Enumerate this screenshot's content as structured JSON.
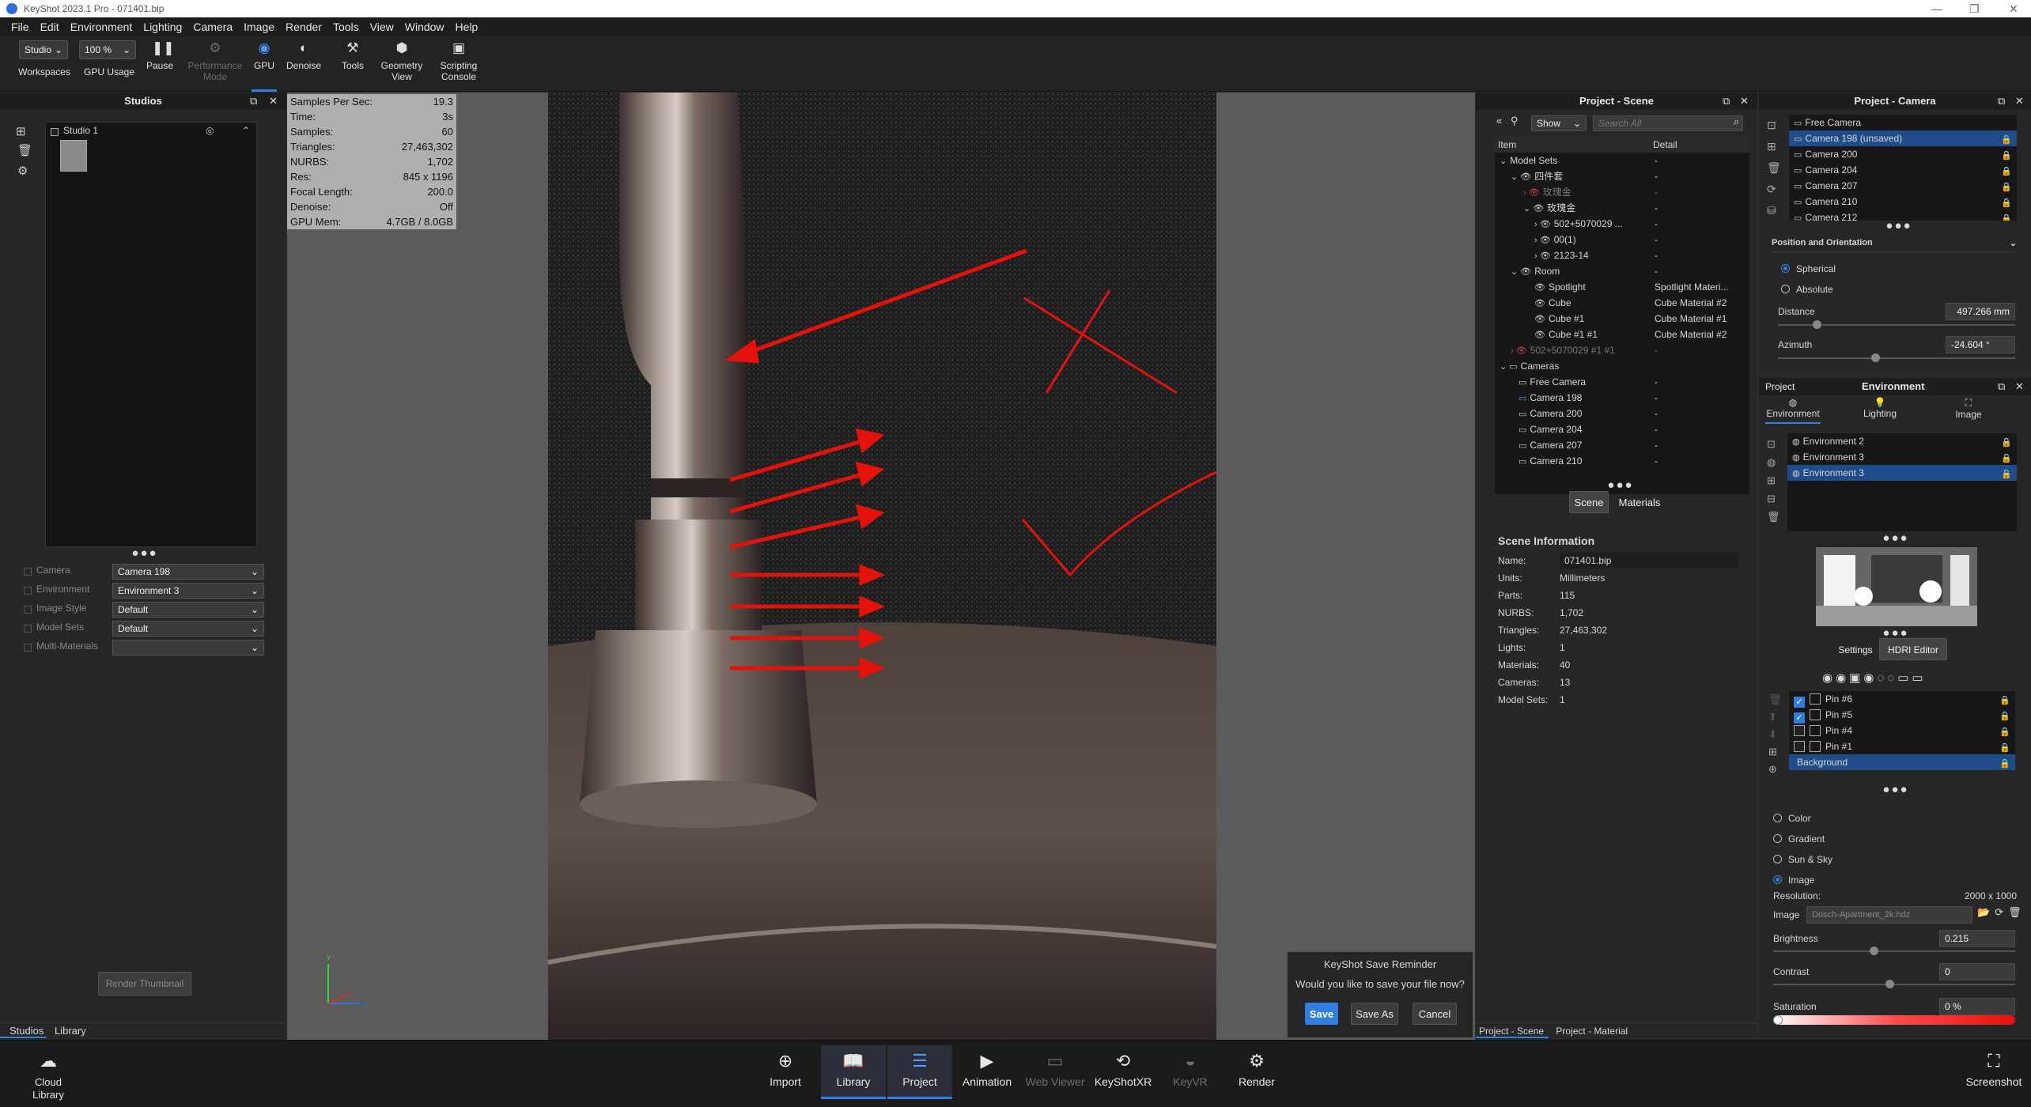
{
  "app": {
    "title": "KeyShot 2023.1 Pro  - 071401.bip",
    "window_controls": [
      "—",
      "❐",
      "✕"
    ]
  },
  "menu": [
    "File",
    "Edit",
    "Environment",
    "Lighting",
    "Camera",
    "Image",
    "Render",
    "Tools",
    "View",
    "Window",
    "Help"
  ],
  "toolbar": {
    "workspace_value": "Studio",
    "workspace_label": "Workspaces",
    "gpu_usage_value": "100 %",
    "gpu_usage_label": "GPU Usage",
    "pause_label": "Pause",
    "performance_label_1": "Performance",
    "performance_label_2": "Mode",
    "gpu_label": "GPU",
    "denoise_label": "Denoise",
    "tools_label": "Tools",
    "geometry_label_1": "Geometry",
    "geometry_label_2": "View",
    "scripting_label_1": "Scripting",
    "scripting_label_2": "Console"
  },
  "studios": {
    "title": "Studios",
    "item": "Studio 1",
    "fields": [
      {
        "label": "Camera",
        "value": "Camera 198"
      },
      {
        "label": "Environment",
        "value": "Environment 3"
      },
      {
        "label": "Image Style",
        "value": "Default"
      },
      {
        "label": "Model Sets",
        "value": "Default"
      },
      {
        "label": "Multi-Materials",
        "value": ""
      }
    ],
    "render_thumbnail": "Render Thumbnail",
    "tabs": [
      "Studios",
      "Library"
    ]
  },
  "stats": [
    {
      "k": "Samples Per Sec:",
      "v": "19.3"
    },
    {
      "k": "Time:",
      "v": "3s"
    },
    {
      "k": "Samples:",
      "v": "60"
    },
    {
      "k": "Triangles:",
      "v": "27,463,302"
    },
    {
      "k": "NURBS:",
      "v": "1,702"
    },
    {
      "k": "Res:",
      "v": "845 x 1196"
    },
    {
      "k": "Focal Length:",
      "v": "200.0"
    },
    {
      "k": "Denoise:",
      "v": "Off"
    },
    {
      "k": "GPU Mem:",
      "v": "4.7GB / 8.0GB"
    }
  ],
  "axes": {
    "y": "y",
    "x": "x",
    "z": "z"
  },
  "save_dialog": {
    "title": "KeyShot Save Reminder",
    "message": "Would you like to save your file now?",
    "save": "Save",
    "save_as": "Save As",
    "cancel": "Cancel"
  },
  "scene": {
    "title": "Project - Scene",
    "show_value": "Show",
    "search_placeholder": "Search All",
    "col_item": "Item",
    "col_detail": "Detail",
    "tree": [
      {
        "label": "Model Sets",
        "detail": "-",
        "indent": 0
      },
      {
        "label": "四件套",
        "detail": "-",
        "indent": 1
      },
      {
        "label": "玫瑰金",
        "detail": "-",
        "indent": 2,
        "dim": true
      },
      {
        "label": "玫瑰金",
        "detail": "-",
        "indent": 2
      },
      {
        "label": "502+5070029 ...",
        "detail": "-",
        "indent": 3
      },
      {
        "label": "00(1)",
        "detail": "-",
        "indent": 3
      },
      {
        "label": "2123-14",
        "detail": "-",
        "indent": 3
      },
      {
        "label": "Room",
        "detail": "-",
        "indent": 1
      },
      {
        "label": "Spotlight",
        "detail": "Spotlight Materi...",
        "indent": 2
      },
      {
        "label": "Cube",
        "detail": "Cube Material #2",
        "indent": 2
      },
      {
        "label": "Cube #1",
        "detail": "Cube Material #1",
        "indent": 2
      },
      {
        "label": "Cube #1 #1",
        "detail": "Cube Material #2",
        "indent": 2
      },
      {
        "label": "502+5070029 #1 #1",
        "detail": "-",
        "indent": 1,
        "dim": true
      },
      {
        "label": "Cameras",
        "detail": "",
        "indent": 0
      },
      {
        "label": "Free Camera",
        "detail": "-",
        "indent": 1
      },
      {
        "label": "Camera 198",
        "detail": "-",
        "indent": 1
      },
      {
        "label": "Camera 200",
        "detail": "-",
        "indent": 1
      },
      {
        "label": "Camera 204",
        "detail": "-",
        "indent": 1
      },
      {
        "label": "Camera 207",
        "detail": "-",
        "indent": 1
      },
      {
        "label": "Camera 210",
        "detail": "-",
        "indent": 1
      }
    ],
    "subtabs": [
      "Scene",
      "Materials"
    ],
    "info_title": "Scene Information",
    "info": [
      {
        "k": "Name:",
        "v": "071401.bip"
      },
      {
        "k": "Units:",
        "v": "Millimeters"
      },
      {
        "k": "Parts:",
        "v": "115"
      },
      {
        "k": "NURBS:",
        "v": "1,702"
      },
      {
        "k": "Triangles:",
        "v": "27,463,302"
      },
      {
        "k": "Lights:",
        "v": "1"
      },
      {
        "k": "Materials:",
        "v": "40"
      },
      {
        "k": "Cameras:",
        "v": "13"
      },
      {
        "k": "Model Sets:",
        "v": "1"
      }
    ],
    "bottom_tabs": [
      "Project - Scene",
      "Project - Material"
    ]
  },
  "camera": {
    "title": "Project - Camera",
    "list": [
      "Free Camera",
      "Camera 198 (unsaved)",
      "Camera 200",
      "Camera 204",
      "Camera 207",
      "Camera 210",
      "Camera 212"
    ],
    "section": "Position and Orientation",
    "spherical": "Spherical",
    "absolute": "Absolute",
    "distance_label": "Distance",
    "distance_value": "497.266 mm",
    "azimuth_label": "Azimuth",
    "azimuth_value": "-24.604 °"
  },
  "environment": {
    "project_label": "Project",
    "title": "Environment",
    "tabs": [
      "Environment",
      "Lighting",
      "Image"
    ],
    "list": [
      "Environment 2",
      "Environment 3",
      "Environment 3"
    ],
    "subtabs": [
      "Settings",
      "HDRI Editor"
    ],
    "pins": [
      "Pin #6",
      "Pin #5",
      "Pin #4",
      "Pin #1"
    ],
    "pins_checked": [
      true,
      true,
      false,
      false
    ],
    "background": "Background",
    "bg_options": [
      "Color",
      "Gradient",
      "Sun & Sky",
      "Image"
    ],
    "resolution_label": "Resolution:",
    "resolution_value": "2000 x 1000",
    "image_label": "Image",
    "image_value": "Dosch-Apartment_2k.hdz",
    "brightness_label": "Brightness",
    "brightness_value": "0.215",
    "contrast_label": "Contrast",
    "contrast_value": "0",
    "saturation_label": "Saturation",
    "saturation_value": "0 %"
  },
  "bottom_nav": [
    {
      "label": "Cloud\nLibrary",
      "icon": "cloud-library-icon"
    },
    {
      "label": "Import",
      "icon": "import-icon"
    },
    {
      "label": "Library",
      "icon": "library-icon"
    },
    {
      "label": "Project",
      "icon": "project-icon"
    },
    {
      "label": "Animation",
      "icon": "animation-icon"
    },
    {
      "label": "Web Viewer",
      "icon": "web-viewer-icon"
    },
    {
      "label": "KeyShotXR",
      "icon": "keyshotxr-icon"
    },
    {
      "label": "KeyVR",
      "icon": "keyvr-icon"
    },
    {
      "label": "Render",
      "icon": "render-icon"
    },
    {
      "label": "Screenshot",
      "icon": "screenshot-icon"
    }
  ],
  "colors": {
    "accent": "#2f7fe0",
    "arrow_red": "#e3120b",
    "selected_row": "#1f4d8a"
  }
}
